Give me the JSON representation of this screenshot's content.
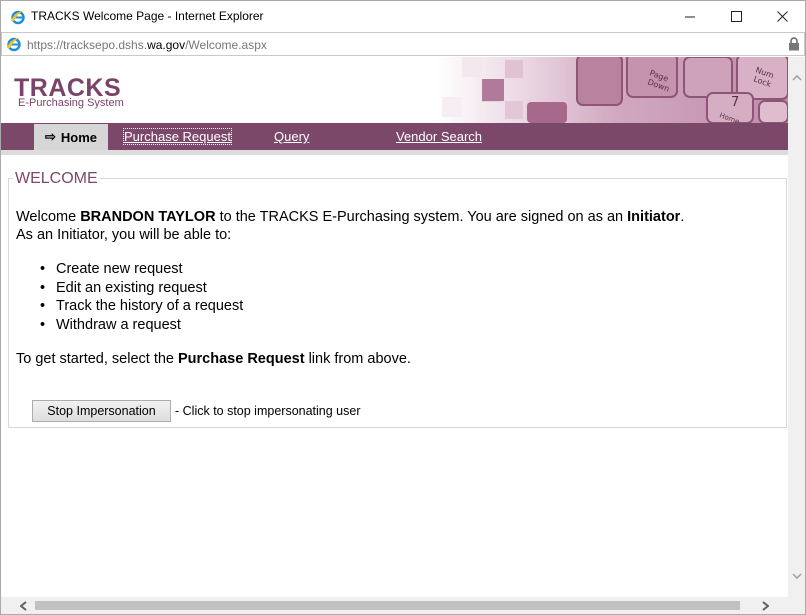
{
  "window": {
    "title": "TRACKS Welcome Page - Internet Explorer",
    "minimize_glyph": "—",
    "maximize_glyph": "☐",
    "close_glyph": "✕"
  },
  "address": {
    "url_prefix": "https://tracksepo.dshs.",
    "url_host": "wa.gov",
    "url_path": "/Welcome.aspx"
  },
  "banner": {
    "logo_title": "TRACKS",
    "logo_subtitle": "E-Purchasing System"
  },
  "nav": {
    "home_label": "Home",
    "home_icon_glyph": "⇨",
    "purchase_request_label": "Purchase Request",
    "query_label": "Query",
    "vendor_search_label": "Vendor Search"
  },
  "welcome": {
    "legend": "WELCOME",
    "intro_prefix": "Welcome ",
    "user_name": "BRANDON TAYLOR",
    "intro_middle": " to the TRACKS E-Purchasing system. You are signed on as an ",
    "role": "Initiator",
    "intro_suffix": ".",
    "abilities_intro": "As an Initiator, you will be able to:",
    "abilities": [
      "Create new request",
      "Edit an existing request",
      "Track the history of a request",
      "Withdraw a request"
    ],
    "getting_started_prefix": "To get started, select the ",
    "getting_started_link": "Purchase Request",
    "getting_started_suffix": " link from above.",
    "stop_button_label": "Stop Impersonation",
    "stop_hint": "- Click to stop impersonating user"
  },
  "colors": {
    "brand_purple": "#7b4869",
    "nav_home_bg": "#d6d6d6"
  }
}
